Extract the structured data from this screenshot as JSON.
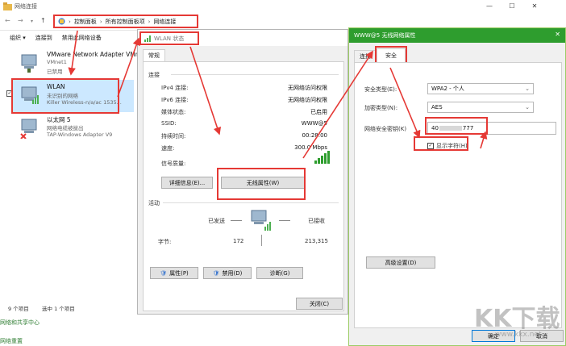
{
  "explorer": {
    "title": "网络连接",
    "breadcrumb": [
      "控制面板",
      "所有控制面板项",
      "网络连接"
    ],
    "commands": [
      "组织 ▾",
      "连接到",
      "禁用此网络设备"
    ],
    "adapters": [
      {
        "name": "VMware Network Adapter VMnet1",
        "line2": "VMnet1",
        "line3": "已禁用"
      },
      {
        "name": "WLAN",
        "line2": "未识别的网络",
        "line3": "Killer Wireless-n/a/ac 1535..."
      },
      {
        "name": "以太网 5",
        "line2": "网络电缆被拔出",
        "line3": "TAP-Windows Adapter V9"
      }
    ],
    "status": {
      "count": "9 个项目",
      "selected": "选中 1 个项目"
    },
    "bottom_links": [
      "网络和共享中心",
      "网络重置"
    ]
  },
  "wlan_status": {
    "title": "WLAN 状态",
    "tab": "常规",
    "connection_heading": "连接",
    "rows": [
      {
        "k": "IPv4 连接:",
        "v": "无网络访问权限"
      },
      {
        "k": "IPv6 连接:",
        "v": "无网络访问权限"
      },
      {
        "k": "媒体状态:",
        "v": "已启用"
      },
      {
        "k": "SSID:",
        "v": "WWW@5"
      },
      {
        "k": "持续时间:",
        "v": "00:28:00"
      },
      {
        "k": "速度:",
        "v": "300.0 Mbps"
      }
    ],
    "signal_label": "信号质量:",
    "details_btn": "详细信息(E)...",
    "wireless_props_btn": "无线属性(W)",
    "activity_heading": "活动",
    "sent_label": "已发送",
    "received_label": "已接收",
    "bytes_label": "字节:",
    "bytes_sent": "172",
    "bytes_received": "213,315",
    "properties_btn": "属性(P)",
    "disable_btn": "禁用(D)",
    "diagnose_btn": "诊断(G)",
    "close_btn": "关闭(C)"
  },
  "wireless_props": {
    "title": "WWW@5 无线网络属性",
    "tabs": [
      "连接",
      "安全"
    ],
    "security_type_label": "安全类型(E):",
    "security_type": "WPA2 - 个人",
    "encryption_label": "加密类型(N):",
    "encryption": "AES",
    "key_label": "网络安全密钥(K)",
    "key_prefix": "40",
    "key_suffix": "777",
    "show_chars_label": "显示字符(H)",
    "advanced_btn": "高级设置(D)",
    "ok_btn": "确定",
    "cancel_btn": "取消"
  },
  "watermark": {
    "text": "KK下载",
    "url": "www.kkx.net"
  },
  "colors": {
    "annotation": "#e53935",
    "selected": "#cce8ff",
    "accent_green": "#2e9d2e"
  }
}
